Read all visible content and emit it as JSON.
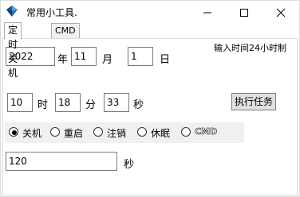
{
  "window": {
    "title": "常用小工具.",
    "icons": {
      "app": "app-gem-icon",
      "minimize": "minimize-icon",
      "maximize": "maximize-icon",
      "close": "close-icon"
    }
  },
  "tabs": [
    {
      "label": "定时关机",
      "active": true
    },
    {
      "label": "CMD指令",
      "active": false
    }
  ],
  "hint": "输入时间24小时制",
  "date": {
    "year": "2022",
    "year_label": "年",
    "month": "11",
    "month_label": "月",
    "day": "1",
    "day_label": "日"
  },
  "time": {
    "hour": "10",
    "hour_label": "时",
    "minute": "18",
    "minute_label": "分",
    "second": "33",
    "second_label": "秒"
  },
  "execute_button": "执行任务",
  "actions": [
    {
      "label": "关机",
      "selected": true
    },
    {
      "label": "重启",
      "selected": false
    },
    {
      "label": "注销",
      "selected": false
    },
    {
      "label": "休眠",
      "selected": false
    },
    {
      "label": "CMD",
      "selected": false
    }
  ],
  "countdown": {
    "value": "120",
    "unit_label": "秒"
  }
}
